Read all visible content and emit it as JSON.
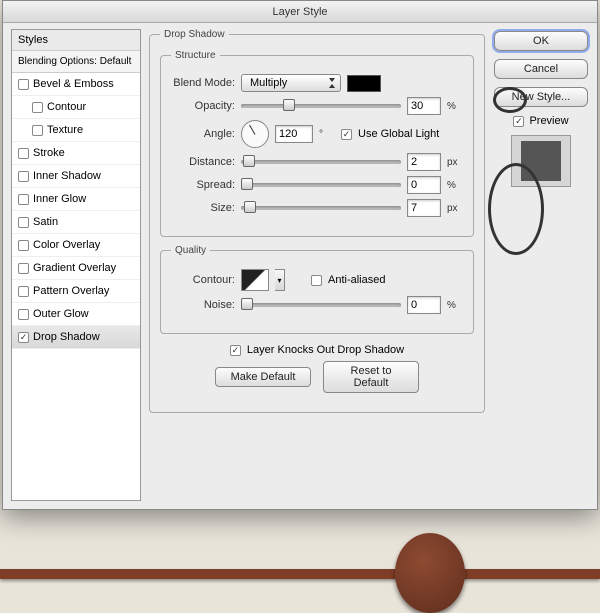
{
  "window": {
    "title": "Layer Style"
  },
  "sidebar": {
    "header": "Styles",
    "sub": "Blending Options: Default",
    "items": [
      {
        "label": "Bevel & Emboss",
        "checked": false,
        "nested": false
      },
      {
        "label": "Contour",
        "checked": false,
        "nested": true
      },
      {
        "label": "Texture",
        "checked": false,
        "nested": true
      },
      {
        "label": "Stroke",
        "checked": false,
        "nested": false
      },
      {
        "label": "Inner Shadow",
        "checked": false,
        "nested": false
      },
      {
        "label": "Inner Glow",
        "checked": false,
        "nested": false
      },
      {
        "label": "Satin",
        "checked": false,
        "nested": false
      },
      {
        "label": "Color Overlay",
        "checked": false,
        "nested": false
      },
      {
        "label": "Gradient Overlay",
        "checked": false,
        "nested": false
      },
      {
        "label": "Pattern Overlay",
        "checked": false,
        "nested": false
      },
      {
        "label": "Outer Glow",
        "checked": false,
        "nested": false
      },
      {
        "label": "Drop Shadow",
        "checked": true,
        "nested": false,
        "selected": true
      }
    ]
  },
  "panel": {
    "title": "Drop Shadow",
    "structure_legend": "Structure",
    "quality_legend": "Quality",
    "blend_mode_label": "Blend Mode:",
    "blend_mode_value": "Multiply",
    "blend_color": "#000000",
    "opacity_label": "Opacity:",
    "opacity_value": "30",
    "opacity_unit": "%",
    "angle_label": "Angle:",
    "angle_value": "120",
    "angle_unit": "°",
    "global_light_label": "Use Global Light",
    "global_light_checked": true,
    "distance_label": "Distance:",
    "distance_value": "2",
    "distance_unit": "px",
    "spread_label": "Spread:",
    "spread_value": "0",
    "spread_unit": "%",
    "size_label": "Size:",
    "size_value": "7",
    "size_unit": "px",
    "contour_label": "Contour:",
    "antialias_label": "Anti-aliased",
    "antialias_checked": false,
    "noise_label": "Noise:",
    "noise_value": "0",
    "noise_unit": "%",
    "knockout_label": "Layer Knocks Out Drop Shadow",
    "knockout_checked": true,
    "make_default": "Make Default",
    "reset_default": "Reset to Default"
  },
  "buttons": {
    "ok": "OK",
    "cancel": "Cancel",
    "new_style": "New Style...",
    "preview": "Preview",
    "preview_checked": true
  }
}
